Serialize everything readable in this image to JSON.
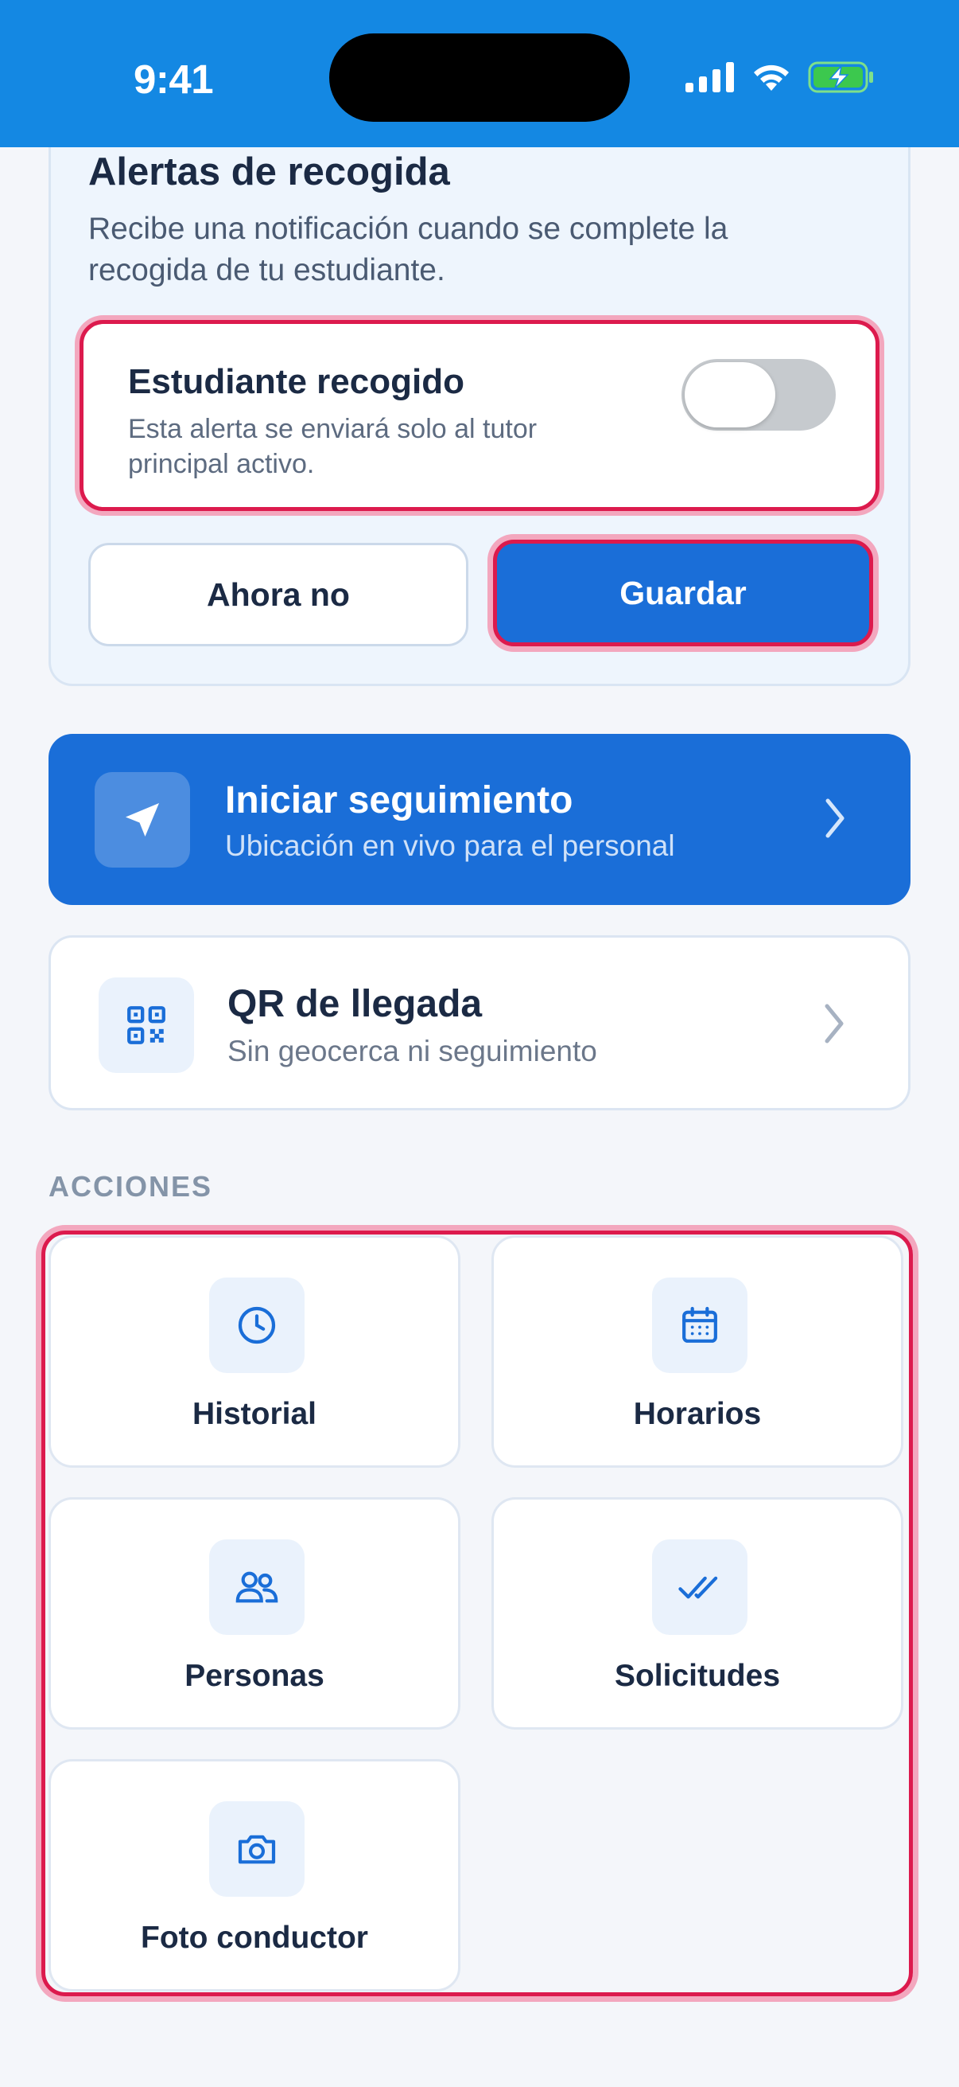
{
  "status_bar": {
    "time": "9:41"
  },
  "pickup_alerts": {
    "title": "Alertas de recogida",
    "description": "Recibe una notificación cuando se complete la recogida de tu estudiante.",
    "toggle": {
      "title": "Estudiante recogido",
      "subtitle": "Esta alerta se enviará solo al tutor principal activo.",
      "enabled": false
    },
    "buttons": {
      "later": "Ahora no",
      "save": "Guardar"
    }
  },
  "tracking": {
    "start": {
      "title": "Iniciar seguimiento",
      "subtitle": "Ubicación en vivo para el personal",
      "icon": "navigation-arrow-icon"
    },
    "qr": {
      "title": "QR de llegada",
      "subtitle": "Sin geocerca ni seguimiento",
      "icon": "qr-code-icon"
    }
  },
  "actions": {
    "label": "ACCIONES",
    "items": [
      {
        "label": "Historial",
        "icon": "clock-icon"
      },
      {
        "label": "Horarios",
        "icon": "calendar-icon"
      },
      {
        "label": "Personas",
        "icon": "people-icon"
      },
      {
        "label": "Solicitudes",
        "icon": "double-check-icon"
      },
      {
        "label": "Foto conductor",
        "icon": "camera-icon"
      }
    ]
  },
  "colors": {
    "status_bar": "#1488e3",
    "primary": "#1a6ed8",
    "highlight_border": "#dc1a4d",
    "card_bg": "#eef5fd",
    "text_dark": "#1b2a44"
  }
}
